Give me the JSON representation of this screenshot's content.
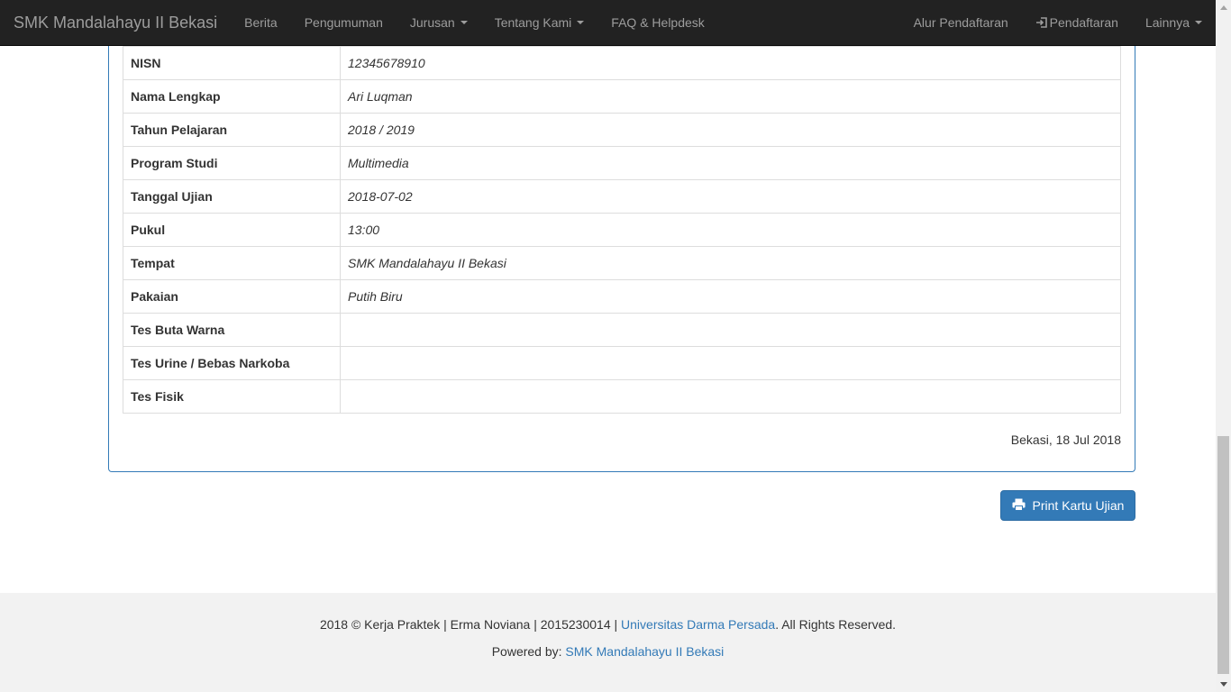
{
  "navbar": {
    "brand": "SMK Mandalahayu II Bekasi",
    "left_items": [
      "Berita",
      "Pengumuman",
      "Jurusan",
      "Tentang Kami",
      "FAQ & Helpdesk"
    ],
    "right_items": [
      "Alur Pendaftaran",
      "Pendaftaran",
      "Lainnya"
    ]
  },
  "table": {
    "rows": [
      {
        "label": "NISN",
        "value": "12345678910"
      },
      {
        "label": "Nama Lengkap",
        "value": "Ari Luqman"
      },
      {
        "label": "Tahun Pelajaran",
        "value": "2018 / 2019"
      },
      {
        "label": "Program Studi",
        "value": "Multimedia"
      },
      {
        "label": "Tanggal Ujian",
        "value": "2018-07-02"
      },
      {
        "label": "Pukul",
        "value": "13:00"
      },
      {
        "label": "Tempat",
        "value": "SMK Mandalahayu II Bekasi"
      },
      {
        "label": "Pakaian",
        "value": "Putih Biru"
      },
      {
        "label": "Tes Buta Warna",
        "value": ""
      },
      {
        "label": "Tes Urine / Bebas Narkoba",
        "value": ""
      },
      {
        "label": "Tes Fisik",
        "value": ""
      }
    ]
  },
  "date_line": "Bekasi, 18 Jul 2018",
  "print_button": {
    "label": "Print Kartu Ujian",
    "icon": "print-icon"
  },
  "footer": {
    "line1_prefix": "2018 © Kerja Praktek | Erma Noviana | 2015230014 | ",
    "line1_link": "Universitas Darma Persada",
    "line1_suffix": ". All Rights Reserved.",
    "line2_prefix": "Powered by: ",
    "line2_link": "SMK Mandalahayu II Bekasi"
  },
  "colors": {
    "navbar_bg": "#222222",
    "primary": "#337ab7",
    "footer_bg": "#f2f2f2"
  }
}
